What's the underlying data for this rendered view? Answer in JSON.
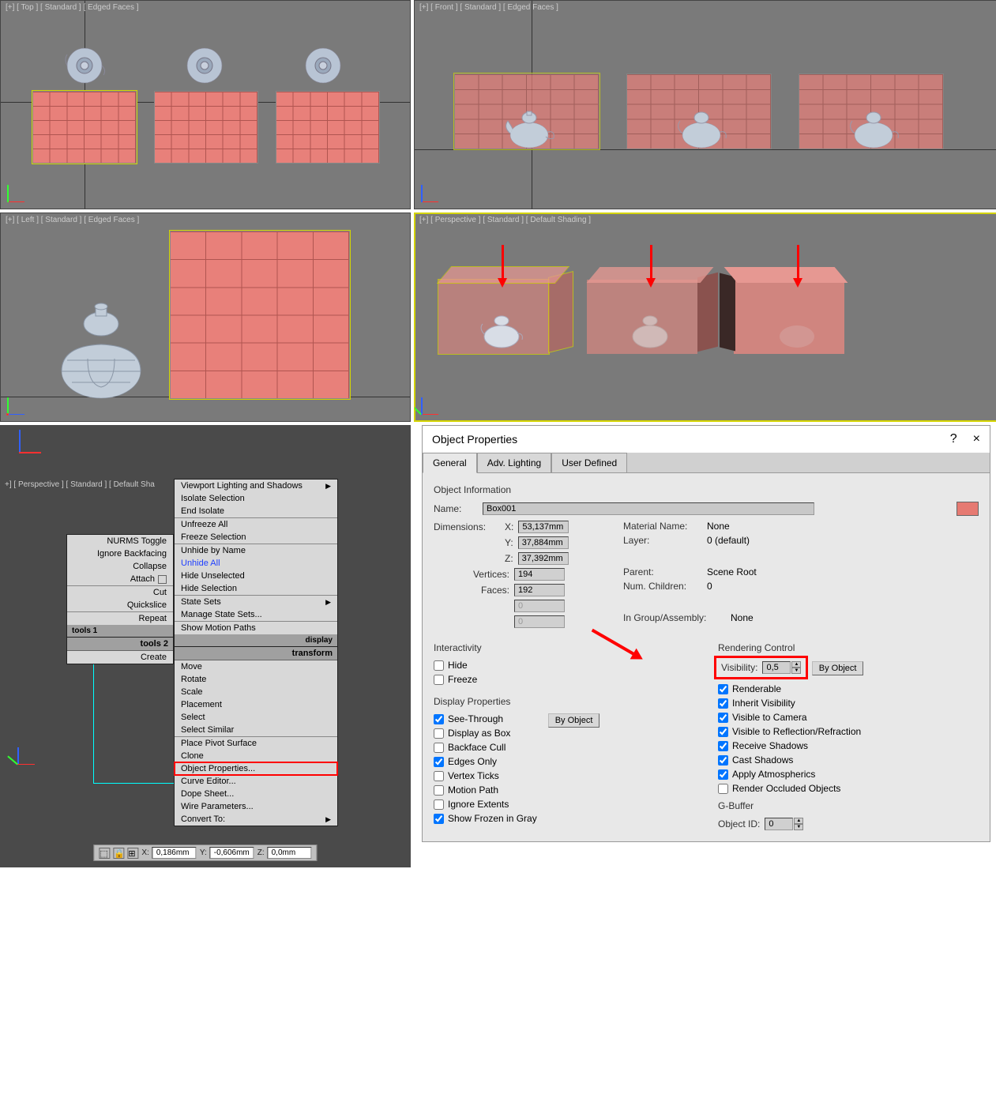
{
  "viewports": {
    "top": {
      "label": "[+] [ Top ] [ Standard ] [ Edged Faces ]"
    },
    "front": {
      "label": "[+] [ Front ] [ Standard ] [ Edged Faces ]"
    },
    "left": {
      "label": "[+] [ Left ] [ Standard ] [ Edged Faces ]"
    },
    "persp": {
      "label": "[+] [ Perspective ] [ Standard ] [ Default Shading ]"
    },
    "persp2": {
      "label": "+] [ Perspective ] [ Standard ] [ Default Sha"
    }
  },
  "context_menu": {
    "col1": {
      "items1": [
        "NURMS Toggle",
        "Ignore Backfacing",
        "Collapse",
        "Attach",
        "Cut",
        "Quickslice",
        "Repeat"
      ],
      "footer1_left": "tools 1",
      "header2_right": "tools 2",
      "items2": [
        "Create"
      ]
    },
    "col2": {
      "header_right": "display",
      "items_a": [
        {
          "t": "Viewport Lighting and Shadows",
          "sub": true
        },
        {
          "t": "Isolate Selection"
        },
        {
          "t": "End Isolate"
        },
        {
          "t": "Unfreeze All"
        },
        {
          "t": "Freeze Selection"
        },
        {
          "t": "Unhide by Name"
        },
        {
          "t": "Unhide All",
          "blue": true
        },
        {
          "t": "Hide Unselected"
        },
        {
          "t": "Hide Selection"
        },
        {
          "t": "State Sets",
          "sub": true
        },
        {
          "t": "Manage State Sets..."
        },
        {
          "t": "Show Motion Paths"
        }
      ],
      "footer_mid": "display",
      "header_b": "transform",
      "items_b": [
        {
          "t": "Move"
        },
        {
          "t": "Rotate"
        },
        {
          "t": "Scale"
        },
        {
          "t": "Placement"
        },
        {
          "t": "Select"
        },
        {
          "t": "Select Similar"
        },
        {
          "t": "Place Pivot Surface"
        },
        {
          "t": "Clone"
        },
        {
          "t": "Object Properties...",
          "hl": true
        },
        {
          "t": "Curve Editor..."
        },
        {
          "t": "Dope Sheet..."
        },
        {
          "t": "Wire Parameters..."
        },
        {
          "t": "Convert To:",
          "sub": true
        }
      ]
    }
  },
  "transform_bar": {
    "x_label": "X:",
    "x": "0,186mm",
    "y_label": "Y:",
    "y": "-0,606mm",
    "z_label": "Z:",
    "z": "0,0mm"
  },
  "dialog": {
    "title": "Object Properties",
    "help": "?",
    "close": "×",
    "tabs": {
      "general": "General",
      "adv": "Adv. Lighting",
      "user": "User Defined"
    },
    "obj_info": "Object Information",
    "name_label": "Name:",
    "name": "Box001",
    "dim_label": "Dimensions:",
    "x_label": "X:",
    "x": "53,137mm",
    "y_label": "Y:",
    "y": "37,884mm",
    "z_label": "Z:",
    "z": "37,392mm",
    "mat_label": "Material Name:",
    "mat": "None",
    "layer_label": "Layer:",
    "layer": "0 (default)",
    "vert_label": "Vertices:",
    "vert": "194",
    "faces_label": "Faces:",
    "faces": "192",
    "blank1": "0",
    "blank2": "0",
    "parent_label": "Parent:",
    "parent": "Scene Root",
    "numc_label": "Num. Children:",
    "numc": "0",
    "grp_label": "In Group/Assembly:",
    "grp": "None",
    "interactivity": "Interactivity",
    "hide": "Hide",
    "freeze": "Freeze",
    "display_props": "Display Properties",
    "see_through": "See-Through",
    "display_box": "Display as Box",
    "backface": "Backface Cull",
    "edges_only": "Edges Only",
    "vertex_ticks": "Vertex Ticks",
    "motion_path": "Motion Path",
    "ignore_ext": "Ignore Extents",
    "show_frozen": "Show Frozen in Gray",
    "by_object": "By Object",
    "rendering": "Rendering Control",
    "visibility_label": "Visibility:",
    "visibility": "0,5",
    "renderable": "Renderable",
    "inherit_vis": "Inherit Visibility",
    "vis_camera": "Visible to Camera",
    "vis_refl": "Visible to Reflection/Refraction",
    "recv_shadow": "Receive Shadows",
    "cast_shadow": "Cast Shadows",
    "apply_atmos": "Apply Atmospherics",
    "render_occ": "Render Occluded Objects",
    "gbuffer": "G-Buffer",
    "objid_label": "Object ID:",
    "objid": "0"
  }
}
